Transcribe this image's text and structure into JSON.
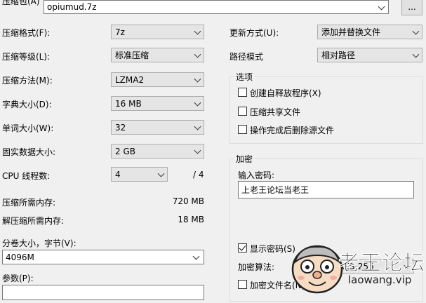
{
  "archive": {
    "label": "压缩包(A)",
    "filename": "opiumud.7z",
    "browse": "..."
  },
  "left": {
    "format": {
      "label": "压缩格式(F):",
      "value": "7z"
    },
    "level": {
      "label": "压缩等级(L):",
      "value": "标准压缩"
    },
    "method": {
      "label": "压缩方法(M):",
      "value": "LZMA2"
    },
    "dict": {
      "label": "字典大小(D):",
      "value": "16 MB"
    },
    "word": {
      "label": "单词大小(W):",
      "value": "32"
    },
    "solid": {
      "label": "固实数据大小:",
      "value": "2 GB"
    },
    "threads": {
      "label": "CPU 线程数:",
      "value": "4",
      "max": "/ 4"
    },
    "mem_compress": {
      "label": "压缩所需内存:",
      "value": "720 MB"
    },
    "mem_decompress": {
      "label": "解压缩所需内存:",
      "value": "18 MB"
    },
    "volume": {
      "label": "分卷大小，字节(V):",
      "value": "4096M"
    },
    "params": {
      "label": "参数(P):",
      "value": ""
    }
  },
  "right": {
    "update": {
      "label": "更新方式(U):",
      "value": "添加并替换文件"
    },
    "path": {
      "label": "路径模式",
      "value": "相对路径"
    },
    "options": {
      "title": "选项",
      "sfx": "创建自释放程序(X)",
      "shared": "压缩共享文件",
      "delete": "操作完成后删除源文件"
    },
    "encrypt": {
      "title": "加密",
      "pw_label": "输入密码:",
      "pw_value": "上老王论坛当老王",
      "show_pw": "显示密码(S)",
      "method_label": "加密算法:",
      "method_value": "AES-256",
      "encrypt_names": "加密文件名(N)"
    }
  },
  "watermark": {
    "text": "老王论坛",
    "url": "laowang.vip"
  }
}
